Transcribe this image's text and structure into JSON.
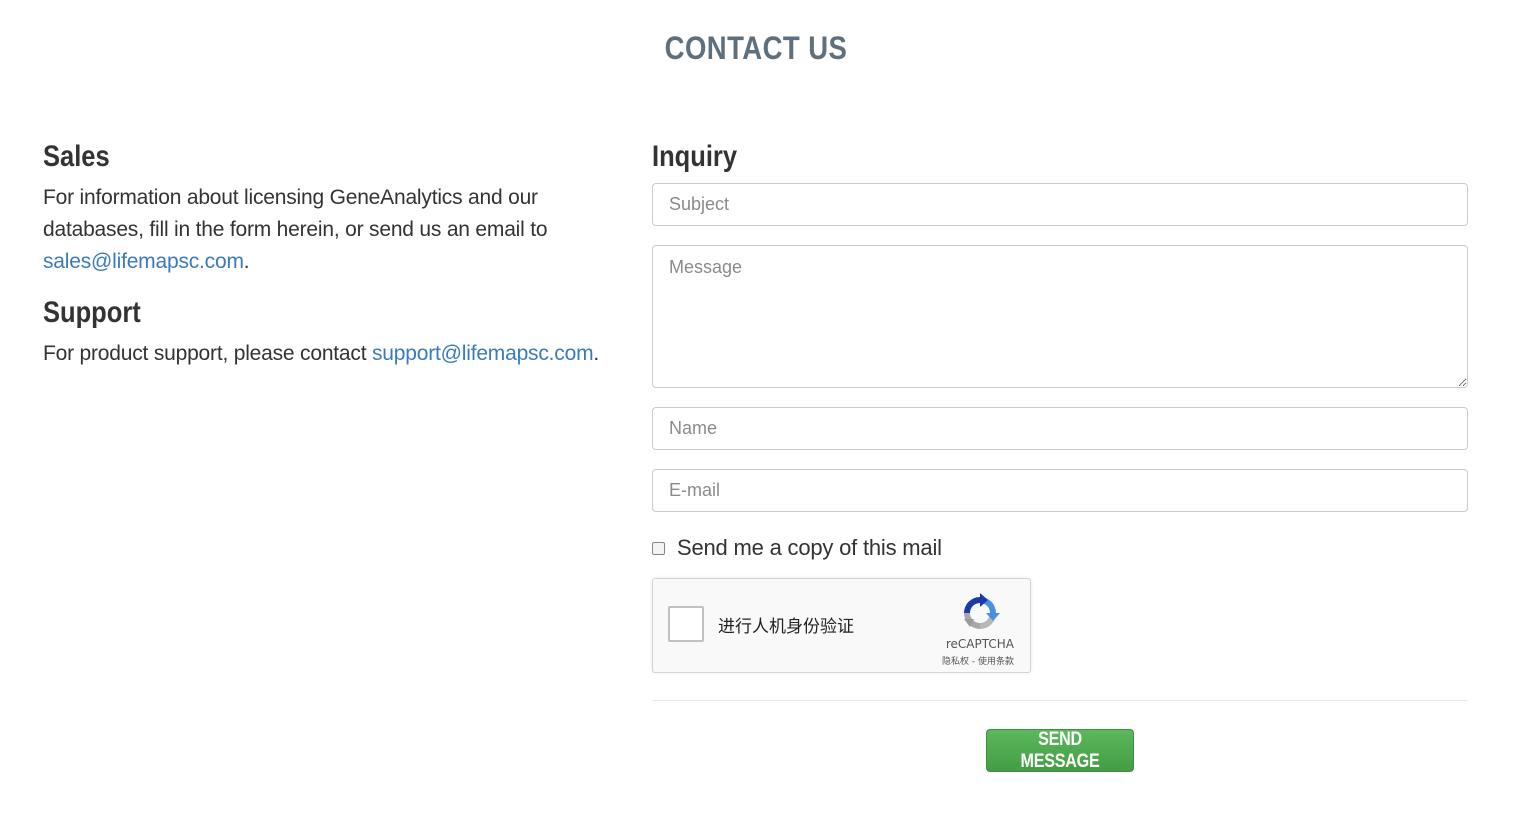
{
  "page": {
    "title": "CONTACT US"
  },
  "sales": {
    "heading": "Sales",
    "text_before": "For information about licensing GeneAnalytics and our databases, fill in the form herein, or send us an email to ",
    "email": "sales@lifemapsc.com",
    "text_after": "."
  },
  "support": {
    "heading": "Support",
    "text_before": "For product support, please contact ",
    "email": "support@lifemapsc.com",
    "text_after": "."
  },
  "inquiry": {
    "heading": "Inquiry",
    "subject_placeholder": "Subject",
    "message_placeholder": "Message",
    "name_placeholder": "Name",
    "email_placeholder": "E-mail",
    "copy_label": "Send me a copy of this mail",
    "copy_checked": false
  },
  "recaptcha": {
    "label": "进行人机身份验证",
    "brand": "reCAPTCHA",
    "terms": "隐私权 - 使用条款"
  },
  "send_button": {
    "label": "SEND MESSAGE"
  },
  "colors": {
    "accent_link": "#3a7bbf",
    "button_green": "#5cb85c",
    "title_gray": "#5f6f7b"
  },
  "icons": {
    "recaptcha_logo": "recaptcha-logo-icon"
  }
}
